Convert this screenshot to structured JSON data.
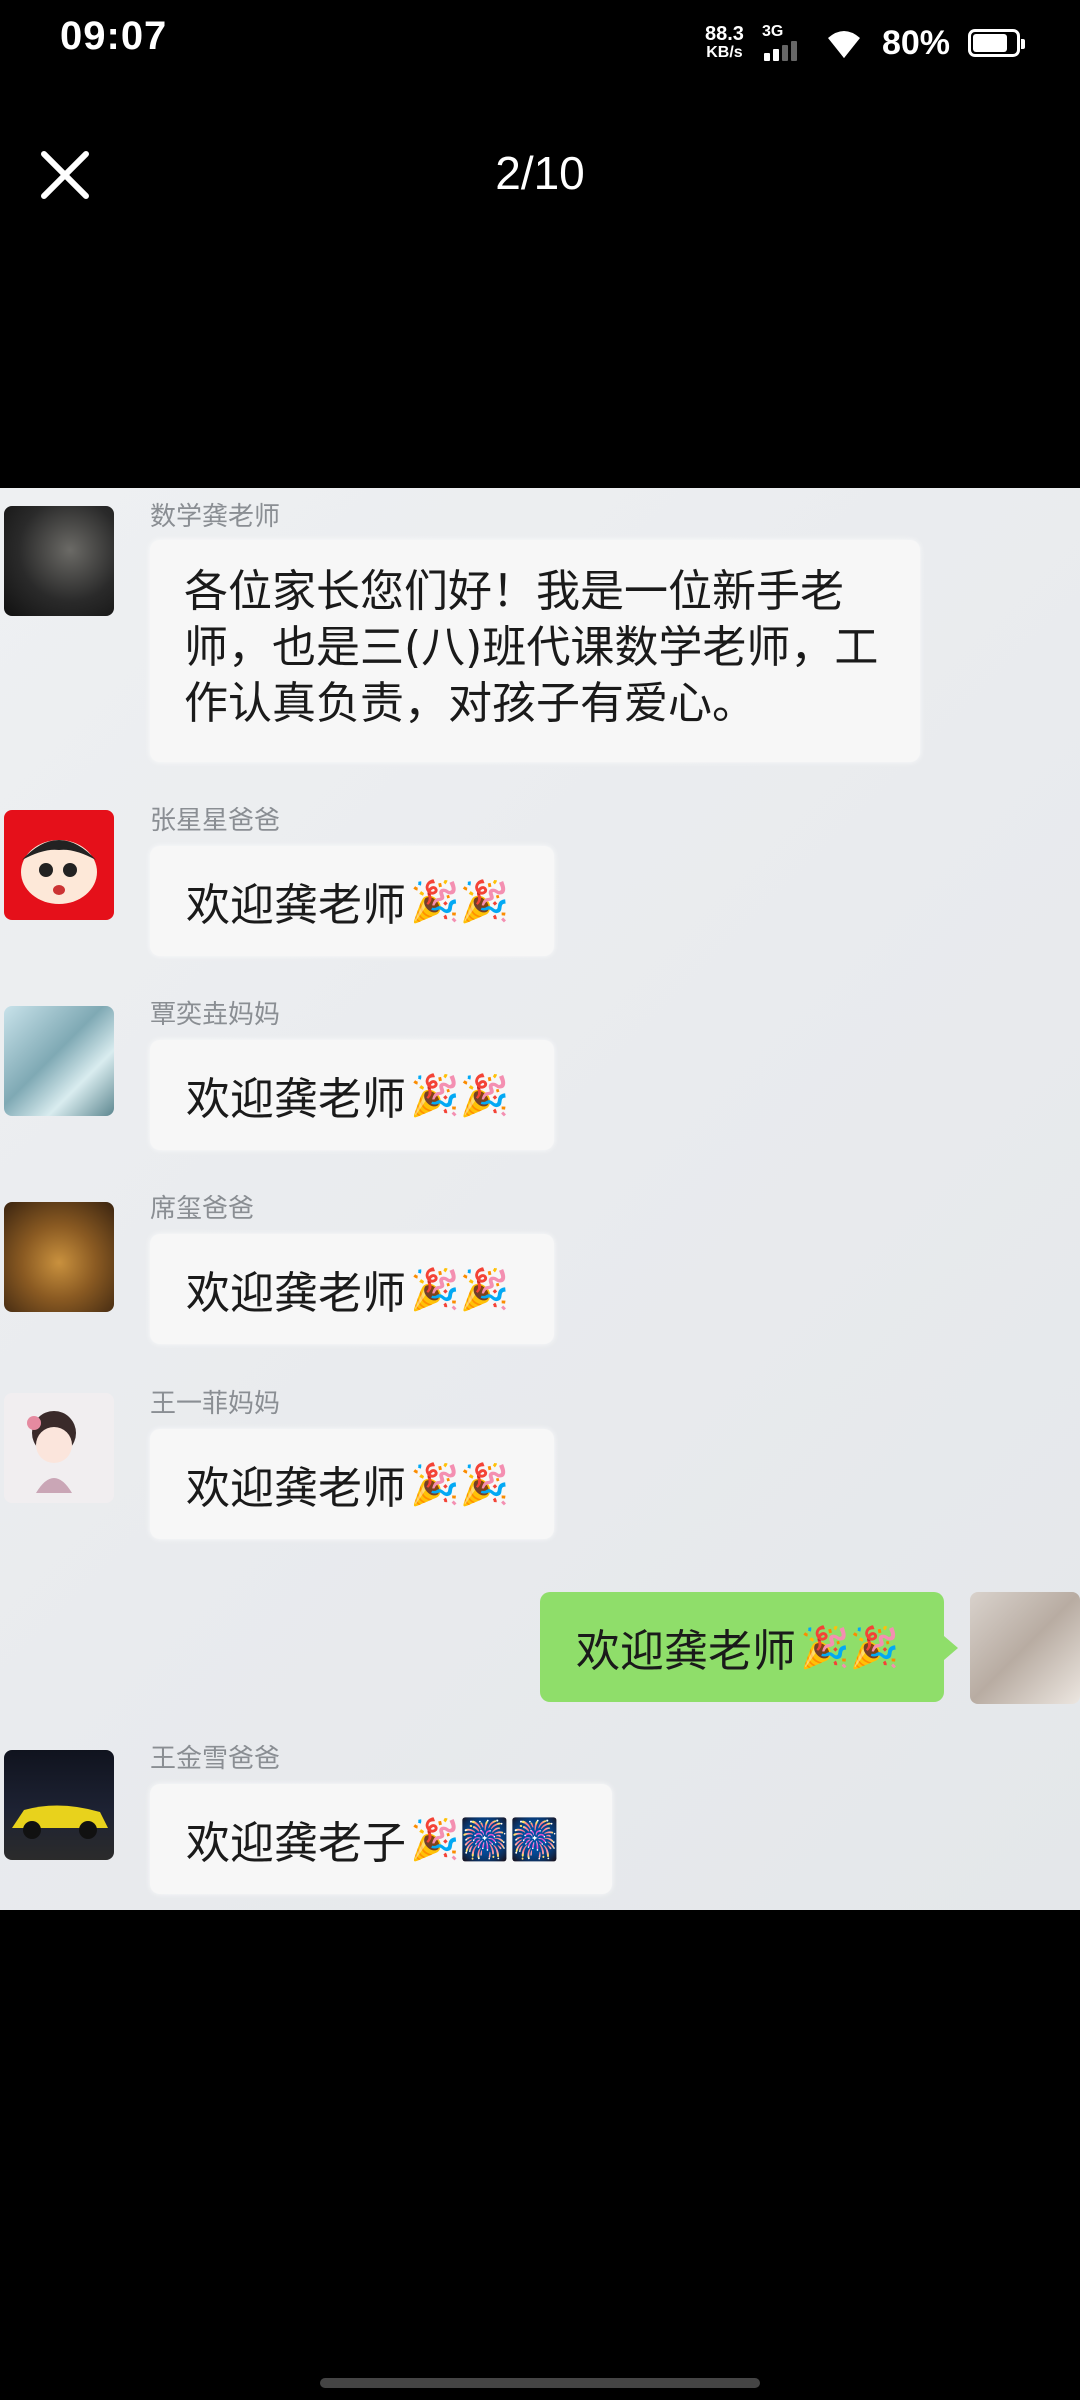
{
  "status_bar": {
    "time": "09:07",
    "net_speed_value": "88.3",
    "net_speed_unit": "KB/s",
    "network_type": "3G",
    "battery_percent": "80%",
    "battery_level": 0.8,
    "icons": [
      "signal-icon",
      "wifi-icon",
      "battery-icon"
    ]
  },
  "viewer": {
    "page_counter": "2/10",
    "close_icon": "close-icon"
  },
  "chat": {
    "messages": [
      {
        "sender": "数学龚老师",
        "text": "各位家长您们好！我是一位新手老师，也是三(八)班代课数学老师，工作认真负责，对孩子有爱心。",
        "mine": false
      },
      {
        "sender": "张星星爸爸",
        "text": "欢迎龚老师",
        "emoji": "🎉🎉",
        "mine": false
      },
      {
        "sender": "覃奕垚妈妈",
        "text": "欢迎龚老师",
        "emoji": "🎉🎉",
        "mine": false
      },
      {
        "sender": "席玺爸爸",
        "text": "欢迎龚老师",
        "emoji": "🎉🎉",
        "mine": false
      },
      {
        "sender": "王一菲妈妈",
        "text": "欢迎龚老师",
        "emoji": "🎉🎉",
        "mine": false
      },
      {
        "sender": "",
        "text": "欢迎龚老师",
        "emoji": "🎉🎉",
        "mine": true
      },
      {
        "sender": "王金雪爸爸",
        "text": "欢迎龚老子",
        "emoji": "🎉🎆🎆",
        "mine": false
      }
    ]
  },
  "colors": {
    "background": "#000000",
    "chat_background": "#eceef0",
    "bubble_other": "#f7f7f7",
    "bubble_mine": "#8fde6a"
  }
}
